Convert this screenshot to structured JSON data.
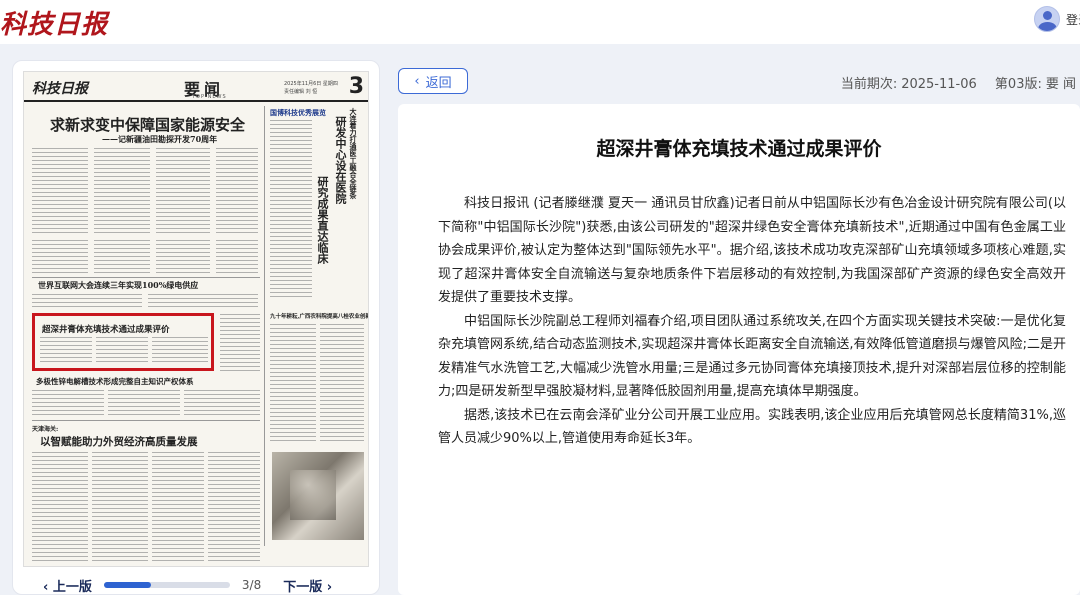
{
  "header": {
    "logo": "科技日报",
    "login_label": "登录"
  },
  "toolbar": {
    "back_label": "返回",
    "issue_label": "当前期次:",
    "issue_date": "2025-11-06",
    "page_label": "第03版:",
    "page_name": "要 闻"
  },
  "newspaper": {
    "logo": "科技日报",
    "section": "要闻",
    "section_en": "TOP NEWS",
    "page_number": "3",
    "date_line": "2025年11月6日 星期四",
    "editor_line": "责任编辑 刘 恒",
    "headlines": {
      "main": "求新求变中保障国家能源安全",
      "main_sub": "——记新疆油田勘探开发70周年",
      "vertical_1": "研发中心设在医院",
      "vertical_2": "研究成果直达临床",
      "vertical_kicker": "大连着力打通医工融合全链条",
      "internet": "世界互联网大会连续三年实现100%绿电供应",
      "target": "超深井膏体充填技术通过成果评价",
      "zinc": "多极性锌电解槽技术形成完整自主知识产权体系",
      "tianjin_kicker": "天津海关:",
      "tianjin": "以智赋能助力外贸经济高质量发展",
      "right_mid": "九十年耕耘,广西农科院提高八桂农业创新\"硬核\"",
      "right_top": "国博科技优秀展览"
    }
  },
  "pager": {
    "prev_label": "上一版",
    "next_label": "下一版",
    "current": 3,
    "total": 8,
    "count_text": "3/8",
    "progress": 0.375
  },
  "article": {
    "title": "超深井膏体充填技术通过成果评价",
    "paragraphs": [
      "科技日报讯 (记者滕继濮 夏天一 通讯员甘欣鑫)记者日前从中铝国际长沙有色冶金设计研究院有限公司(以下简称\"中铝国际长沙院\")获悉,由该公司研发的\"超深井绿色安全膏体充填新技术\",近期通过中国有色金属工业协会成果评价,被认定为整体达到\"国际领先水平\"。据介绍,该技术成功攻克深部矿山充填领域多项核心难题,实现了超深井膏体安全自流输送与复杂地质条件下岩层移动的有效控制,为我国深部矿产资源的绿色安全高效开发提供了重要技术支撑。",
      "中铝国际长沙院副总工程师刘福春介绍,项目团队通过系统攻关,在四个方面实现关键技术突破:一是优化复杂充填管网系统,结合动态监测技术,实现超深井膏体长距离安全自流输送,有效降低管道磨损与爆管风险;二是开发精准气水洗管工艺,大幅减少洗管水用量;三是通过多元协同膏体充填接顶技术,提升对深部岩层位移的控制能力;四是研发新型早强胶凝材料,显著降低胶固剂用量,提高充填体早期强度。",
      "据悉,该技术已在云南会泽矿业分公司开展工业应用。实践表明,该企业应用后充填管网总长度精简31%,巡管人员减少90%以上,管道使用寿命延长3年。"
    ]
  },
  "colors": {
    "accent": "#3c6ad6",
    "brand_red": "#b0161c",
    "highlight_red": "#c8161d",
    "panel_bg": "#eef1f7"
  }
}
